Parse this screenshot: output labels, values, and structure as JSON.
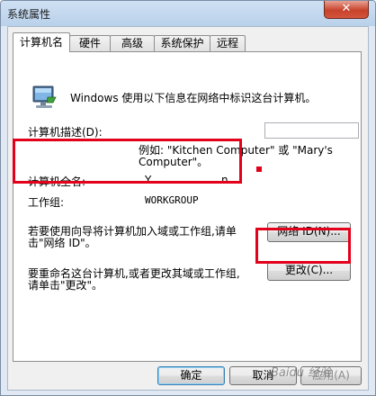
{
  "window": {
    "title": "系统属性",
    "close_glyph": "✕"
  },
  "tabs": [
    {
      "label": "计算机名",
      "active": true
    },
    {
      "label": "硬件"
    },
    {
      "label": "高级"
    },
    {
      "label": "系统保护"
    },
    {
      "label": "远程"
    }
  ],
  "computer_name_tab": {
    "intro": "Windows 使用以下信息在网络中标识这台计算机。",
    "description_label": "计算机描述(D):",
    "description_value": "",
    "example_line1": "例如: \"Kitchen Computer\" 或 \"Mary's",
    "example_line2": "Computer\"。",
    "full_name_label": "计算机全名:",
    "full_name_value_a": "Y",
    "full_name_value_b": "n",
    "workgroup_label": "工作组:",
    "workgroup_value": "WORKGROUP",
    "network_id_text_line1": "若要使用向导将计算机加入域或工作组,请单",
    "network_id_text_line2": "击\"网络 ID\"。",
    "network_id_button": "网络 ID(N)...",
    "rename_text_line1": "要重命名这台计算机,或者更改其域或工作组,",
    "rename_text_line2": "请单击\"更改\"。",
    "change_button": "更改(C)..."
  },
  "footer": {
    "ok_button": "确定",
    "cancel_button": "取消",
    "apply_button": "应用(A)"
  },
  "colors": {
    "highlight": "#e2001a",
    "accent": "#3c7fb1"
  },
  "watermark": "Baidu 经验"
}
